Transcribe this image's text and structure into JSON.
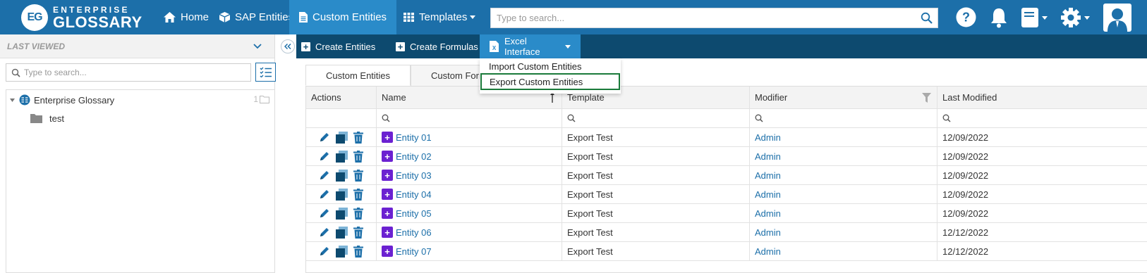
{
  "logo": {
    "mark": "EG",
    "top": "ENTERPRISE",
    "bottom": "GLOSSARY"
  },
  "nav": {
    "home": "Home",
    "sap_entities": "SAP Entities",
    "custom_entities": "Custom Entities",
    "templates": "Templates"
  },
  "search": {
    "placeholder": "Type to search..."
  },
  "toolbar": {
    "create_entities": "Create Entities",
    "create_formulas": "Create Formulas",
    "excel_interface": "Excel Interface"
  },
  "excel_menu": {
    "import": "Import Custom Entities",
    "export": "Export Custom Entities"
  },
  "left_panel": {
    "title": "LAST VIEWED",
    "search_placeholder": "Type to search...",
    "tree": {
      "root_label": "Enterprise Glossary",
      "root_count": "1",
      "child_label": "test"
    }
  },
  "tabs": [
    "Custom Entities",
    "Custom Formulas"
  ],
  "grid": {
    "columns": {
      "actions": "Actions",
      "name": "Name",
      "template": "Template",
      "modifier": "Modifier",
      "last_modified": "Last Modified"
    },
    "rows": [
      {
        "name": "Entity 01",
        "template": "Export Test",
        "modifier": "Admin",
        "last_modified": "12/09/2022"
      },
      {
        "name": "Entity 02",
        "template": "Export Test",
        "modifier": "Admin",
        "last_modified": "12/09/2022"
      },
      {
        "name": "Entity 03",
        "template": "Export Test",
        "modifier": "Admin",
        "last_modified": "12/09/2022"
      },
      {
        "name": "Entity 04",
        "template": "Export Test",
        "modifier": "Admin",
        "last_modified": "12/09/2022"
      },
      {
        "name": "Entity 05",
        "template": "Export Test",
        "modifier": "Admin",
        "last_modified": "12/09/2022"
      },
      {
        "name": "Entity 06",
        "template": "Export Test",
        "modifier": "Admin",
        "last_modified": "12/12/2022"
      },
      {
        "name": "Entity 07",
        "template": "Export Test",
        "modifier": "Admin",
        "last_modified": "12/12/2022"
      }
    ]
  },
  "colors": {
    "topbar": "#1c6fa9",
    "active_nav": "#2a8bc9",
    "subbar": "#0d4a6f",
    "link": "#1c6fa9",
    "entity_badge": "#6b21d1",
    "highlight_border": "#1a7a3a"
  },
  "icons": {
    "home": "home-icon",
    "sap": "cube-icon",
    "custom": "document-icon",
    "templates": "grid-icon",
    "help": "help-icon",
    "bell": "bell-icon",
    "book": "book-icon",
    "settings": "gear-icon",
    "user": "user-avatar-icon",
    "excel": "excel-icon"
  }
}
